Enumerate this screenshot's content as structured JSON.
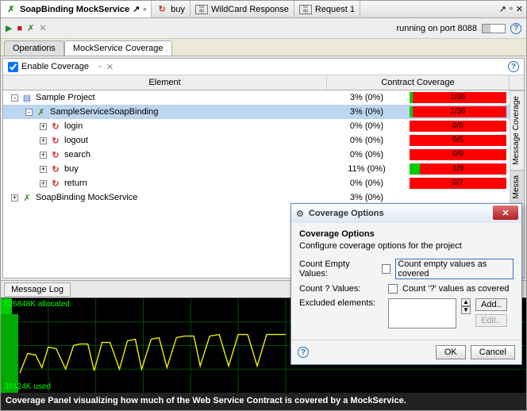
{
  "docTabs": [
    {
      "icon": "x",
      "label": "SoapBinding MockService",
      "active": true
    },
    {
      "icon": "cycle",
      "label": "buy"
    },
    {
      "icon": "soap",
      "label": "WildCard Response"
    },
    {
      "icon": "soap",
      "label": "Request 1"
    }
  ],
  "portText": "running on port 8088",
  "innerTabs": [
    {
      "label": "Operations",
      "active": false
    },
    {
      "label": "MockService Coverage",
      "active": true
    }
  ],
  "enableCoverageLabel": "Enable Coverage",
  "columns": {
    "element": "Element",
    "coverage": "Contract Coverage"
  },
  "tree": [
    {
      "indent": 0,
      "toggle": "-",
      "icon": "proj",
      "label": "Sample Project",
      "pct": "3% (0%)",
      "count": "1/36",
      "fill": 3,
      "selected": false
    },
    {
      "indent": 1,
      "toggle": "-",
      "icon": "x",
      "label": "SampleServiceSoapBinding",
      "pct": "3% (0%)",
      "count": "1/36",
      "fill": 3,
      "selected": true
    },
    {
      "indent": 2,
      "toggle": "+",
      "icon": "cycle",
      "label": "login",
      "pct": "0% (0%)",
      "count": "0/6",
      "fill": 0,
      "selected": false
    },
    {
      "indent": 2,
      "toggle": "+",
      "icon": "cycle",
      "label": "logout",
      "pct": "0% (0%)",
      "count": "0/5",
      "fill": 0,
      "selected": false
    },
    {
      "indent": 2,
      "toggle": "+",
      "icon": "cycle",
      "label": "search",
      "pct": "0% (0%)",
      "count": "0/9",
      "fill": 0,
      "selected": false
    },
    {
      "indent": 2,
      "toggle": "+",
      "icon": "cycle",
      "label": "buy",
      "pct": "11% (0%)",
      "count": "1/9",
      "fill": 11,
      "selected": false
    },
    {
      "indent": 2,
      "toggle": "+",
      "icon": "cycle",
      "label": "return",
      "pct": "0% (0%)",
      "count": "0/7",
      "fill": 0,
      "selected": false
    },
    {
      "indent": 0,
      "toggle": "+",
      "icon": "x",
      "label": "SoapBinding MockService",
      "pct": "3% (0%)",
      "count": "",
      "fill": 0,
      "selected": false
    }
  ],
  "vtabs": [
    {
      "label": "Message Coverage",
      "active": false
    },
    {
      "label": "Messa",
      "active": true
    }
  ],
  "messageLog": "Message Log",
  "graph": {
    "allocated": "126848K allocated",
    "used": "38124K used"
  },
  "caption": "Coverage Panel visualizing how much of the Web Service Contract is covered by a MockService.",
  "dialog": {
    "winTitle": "Coverage Options",
    "heading": "Coverage Options",
    "desc": "Configure coverage options for the project",
    "countEmptyLabel": "Count Empty Values:",
    "countEmptyCheck": "Count empty values as covered",
    "countQLabel": "Count ? Values:",
    "countQCheck": "Count '?' values as covered",
    "excludedLabel": "Excluded elements:",
    "addBtn": "Add..",
    "editBtn": "Edit..",
    "okBtn": "OK",
    "cancelBtn": "Cancel"
  }
}
